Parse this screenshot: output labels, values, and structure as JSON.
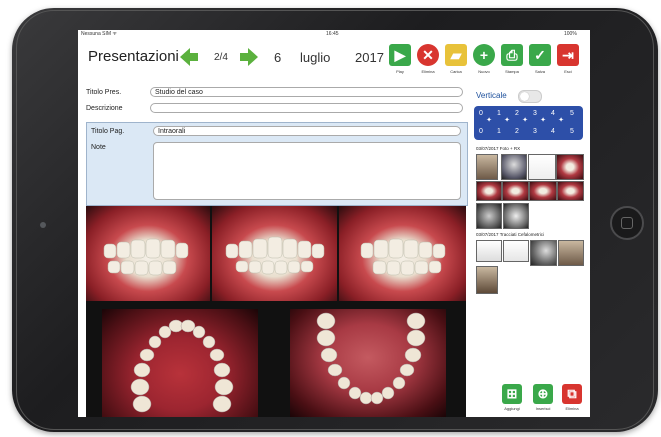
{
  "status_bar": {
    "carrier": "Nessuna SIM ᯤ",
    "time": "16:45",
    "battery": "100%"
  },
  "header": {
    "title": "Presentazioni",
    "page_indicator": "2/4",
    "date_day": "6",
    "date_month": "luglio",
    "date_year": "2017"
  },
  "toolbar": {
    "buttons": [
      {
        "label": "Play",
        "icon": "play-icon",
        "color": "#3aa84a"
      },
      {
        "label": "Elimina",
        "icon": "delete-icon",
        "color": "#d8352f"
      },
      {
        "label": "Carica",
        "icon": "folder-icon",
        "color": "#e8c23a"
      },
      {
        "label": "Nuovo",
        "icon": "plus-icon",
        "color": "#3aa84a"
      },
      {
        "label": "Stampa",
        "icon": "printer-icon",
        "color": "#3aa84a"
      },
      {
        "label": "Salva",
        "icon": "check-icon",
        "color": "#3aa84a"
      },
      {
        "label": "Esci",
        "icon": "exit-icon",
        "color": "#d8352f"
      }
    ]
  },
  "form": {
    "titolo_pres_label": "Titolo Pres.",
    "titolo_pres_value": "Studio del caso",
    "descrizione_label": "Descrizione",
    "descrizione_value": "",
    "titolo_pag_label": "Titolo Pag.",
    "titolo_pag_value": "Intraorali",
    "note_label": "Note",
    "note_value": ""
  },
  "sidebar": {
    "verticale_label": "Verticale",
    "verticale_on": false,
    "numbers_top": [
      "0",
      "1",
      "2",
      "3",
      "4",
      "5"
    ],
    "numbers_bottom": [
      "0",
      "1",
      "2",
      "3",
      "4",
      "5"
    ],
    "group1_label": "03/07/2017 Foto + RX",
    "group2_label": "03/07/2017 Tracciati Cefalometrici"
  },
  "bottom_buttons": [
    {
      "label": "Aggiungi",
      "icon": "add-icon",
      "color": "#3aa84a"
    },
    {
      "label": "Inserisci",
      "icon": "insert-icon",
      "color": "#3aa84a"
    },
    {
      "label": "Elimina",
      "icon": "delete-pages-icon",
      "color": "#d8352f"
    }
  ],
  "colors": {
    "accent_blue": "#2d4fa8",
    "green": "#3aa84a",
    "red": "#d8352f"
  }
}
